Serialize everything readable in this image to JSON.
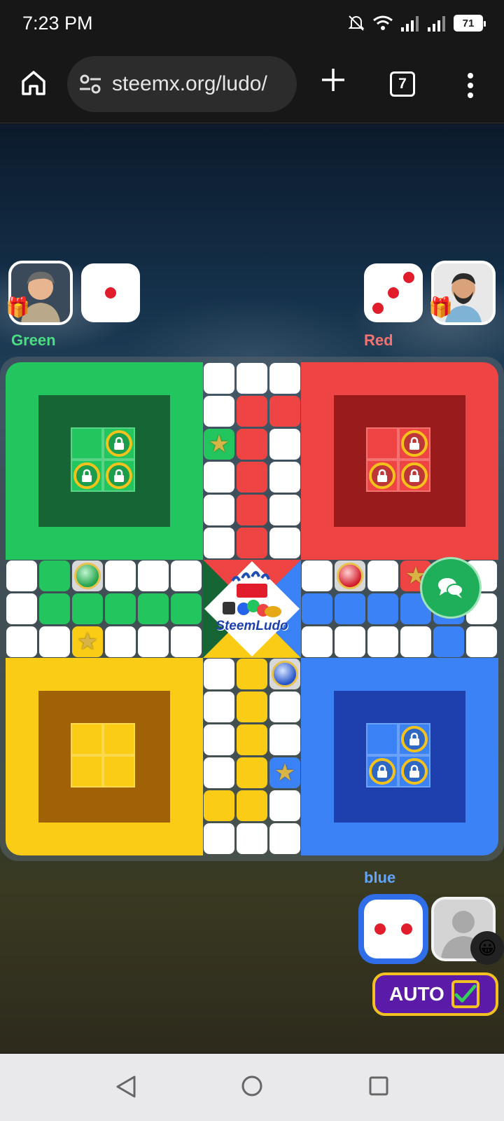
{
  "status_bar": {
    "time": "7:23 PM",
    "battery": "71"
  },
  "browser": {
    "url": "steemx.org/ludo/",
    "tab_count": "7"
  },
  "players": {
    "green": {
      "name": "Green",
      "dice_value": 1,
      "color": "#22c55e"
    },
    "red": {
      "name": "Red",
      "dice_value": 3,
      "color": "#ef4444"
    },
    "blue": {
      "name": "blue",
      "dice_value": 2,
      "color": "#60a5fa"
    }
  },
  "board": {
    "colors": {
      "green": "#22c55e",
      "red": "#ef4444",
      "yellow": "#facc15",
      "blue": "#3b82f6"
    },
    "logo_text": "SteemLudo"
  },
  "controls": {
    "auto_label": "AUTO",
    "auto_checked": true
  },
  "icons": [
    "home-icon",
    "site-settings-icon",
    "new-tab-icon",
    "more-menu-icon",
    "lock-icon",
    "star-icon",
    "chat-icon",
    "gift-icon",
    "emoji-icon",
    "back-nav-icon",
    "home-nav-icon",
    "recents-nav-icon"
  ]
}
